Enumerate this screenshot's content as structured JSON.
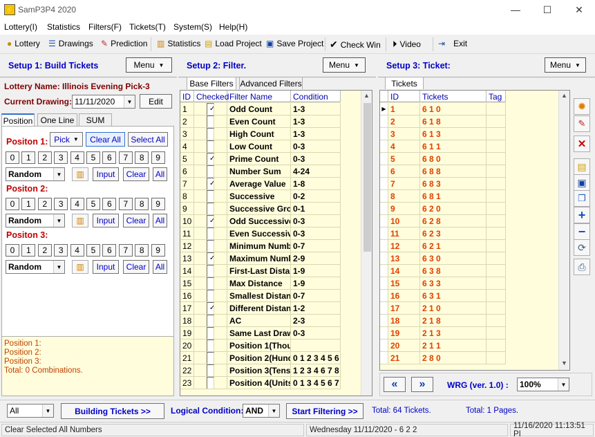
{
  "window": {
    "title": "SamP3P4 2020"
  },
  "menu": [
    "Lottery(I)",
    "Statistics",
    "Filters(F)",
    "Tickets(T)",
    "System(S)",
    "Help(H)"
  ],
  "toolbar": {
    "lottery": "Lottery",
    "drawings": "Drawings",
    "prediction": "Prediction",
    "statistics": "Statistics",
    "load_project": "Load Project",
    "save_project": "Save Project",
    "check_win": "Check Win",
    "video": "Video",
    "exit": "Exit"
  },
  "setup1": {
    "title": "Setup 1: Build  Tickets",
    "menu_label": "Menu",
    "lottery_label": "Lottery  Name:",
    "lottery_name": "Illinois Evening Pick-3",
    "current_drawing_label": "Current Drawing:",
    "current_drawing": "11/11/2020",
    "edit_label": "Edit",
    "tabs": [
      "Position",
      "One Line",
      "SUM"
    ],
    "pick_label": "Pick",
    "clear_all_label": "Clear All",
    "select_all_label": "Select All",
    "digits": [
      "0",
      "1",
      "2",
      "3",
      "4",
      "5",
      "6",
      "7",
      "8",
      "9"
    ],
    "positions": [
      {
        "label": "Positon 1:",
        "mode": "Random"
      },
      {
        "label": "Positon 2:",
        "mode": "Random"
      },
      {
        "label": "Positon 3:",
        "mode": "Random"
      }
    ],
    "input_label": "Input",
    "clear_label": "Clear",
    "all_label": "All",
    "summary": [
      "Position 1:",
      "Position 2:",
      "Position 3:",
      "Total: 0 Combinations."
    ]
  },
  "setup2": {
    "title": "Setup 2: Filter.",
    "menu_label": "Menu",
    "tabs": [
      "Base Filters",
      "Advanced Filters"
    ],
    "columns": [
      "ID",
      "Checked",
      "Filter Name",
      "Condition"
    ],
    "rows": [
      {
        "id": "1",
        "checked": true,
        "name": "Odd Count",
        "cond": "1-3"
      },
      {
        "id": "2",
        "checked": false,
        "name": "Even Count",
        "cond": "1-3"
      },
      {
        "id": "3",
        "checked": false,
        "name": "High Count",
        "cond": "1-3"
      },
      {
        "id": "4",
        "checked": false,
        "name": "Low Count",
        "cond": "0-3"
      },
      {
        "id": "5",
        "checked": true,
        "name": "Prime Count",
        "cond": "0-3"
      },
      {
        "id": "6",
        "checked": false,
        "name": "Number Sum",
        "cond": "4-24"
      },
      {
        "id": "7",
        "checked": true,
        "name": "Average Value",
        "cond": "1-8"
      },
      {
        "id": "8",
        "checked": false,
        "name": "Successive",
        "cond": "0-2"
      },
      {
        "id": "9",
        "checked": false,
        "name": "Successive Gro",
        "cond": "0-1"
      },
      {
        "id": "10",
        "checked": true,
        "name": "Odd Successive",
        "cond": "0-3"
      },
      {
        "id": "11",
        "checked": false,
        "name": "Even Successiv",
        "cond": "0-3"
      },
      {
        "id": "12",
        "checked": false,
        "name": "Minimum Numbe",
        "cond": "0-7"
      },
      {
        "id": "13",
        "checked": true,
        "name": "Maximum Numbe",
        "cond": "2-9"
      },
      {
        "id": "14",
        "checked": false,
        "name": "First-Last Distan",
        "cond": "1-9"
      },
      {
        "id": "15",
        "checked": false,
        "name": "Max Distance",
        "cond": "1-9"
      },
      {
        "id": "16",
        "checked": false,
        "name": "Smallest Distanc",
        "cond": "0-7"
      },
      {
        "id": "17",
        "checked": true,
        "name": "Different Distanc",
        "cond": "1-2"
      },
      {
        "id": "18",
        "checked": false,
        "name": "AC",
        "cond": "2-3"
      },
      {
        "id": "19",
        "checked": false,
        "name": "Same Last Draw",
        "cond": "0-3"
      },
      {
        "id": "20",
        "checked": false,
        "name": "Position 1(Thous",
        "cond": ""
      },
      {
        "id": "21",
        "checked": false,
        "name": "Position 2(Hund",
        "cond": "0 1 2 3 4 5 6"
      },
      {
        "id": "22",
        "checked": false,
        "name": "Position 3(Tens)",
        "cond": "1 2 3 4 6 7 8"
      },
      {
        "id": "23",
        "checked": false,
        "name": "Position 4(Units",
        "cond": "0 1 3 4 5 6 7"
      }
    ]
  },
  "setup3": {
    "title": "Setup 3: Ticket:",
    "menu_label": "Menu",
    "tab": "Tickets",
    "columns": [
      "ID",
      "Tickets",
      "Tag"
    ],
    "rows": [
      {
        "id": "1",
        "t": "6 1 0"
      },
      {
        "id": "2",
        "t": "6 1 8"
      },
      {
        "id": "3",
        "t": "6 1 3"
      },
      {
        "id": "4",
        "t": "6 1 1"
      },
      {
        "id": "5",
        "t": "6 8 0"
      },
      {
        "id": "6",
        "t": "6 8 8"
      },
      {
        "id": "7",
        "t": "6 8 3"
      },
      {
        "id": "8",
        "t": "6 8 1"
      },
      {
        "id": "9",
        "t": "6 2 0"
      },
      {
        "id": "10",
        "t": "6 2 8"
      },
      {
        "id": "11",
        "t": "6 2 3"
      },
      {
        "id": "12",
        "t": "6 2 1"
      },
      {
        "id": "13",
        "t": "6 3 0"
      },
      {
        "id": "14",
        "t": "6 3 8"
      },
      {
        "id": "15",
        "t": "6 3 3"
      },
      {
        "id": "16",
        "t": "6 3 1"
      },
      {
        "id": "17",
        "t": "2 1 0"
      },
      {
        "id": "18",
        "t": "2 1 8"
      },
      {
        "id": "19",
        "t": "2 1 3"
      },
      {
        "id": "20",
        "t": "2 1 1"
      },
      {
        "id": "21",
        "t": "2 8 0"
      }
    ],
    "wrg_label": "WRG (ver. 1.0) :",
    "zoom": "100%"
  },
  "bottom": {
    "all_select": "All",
    "building_label": "Building  Tickets >>",
    "logical_label": "Logical Condition:",
    "logical_value": "AND",
    "start_filtering": "Start Filtering  >>",
    "total_tickets": "Total: 64 Tickets.",
    "total_pages": "Total: 1 Pages."
  },
  "status": {
    "left": "Clear Selected All Numbers",
    "middle": "Wednesday 11/11/2020 - 6 2 2",
    "right": "11/16/2020 11:13:51 PI"
  }
}
